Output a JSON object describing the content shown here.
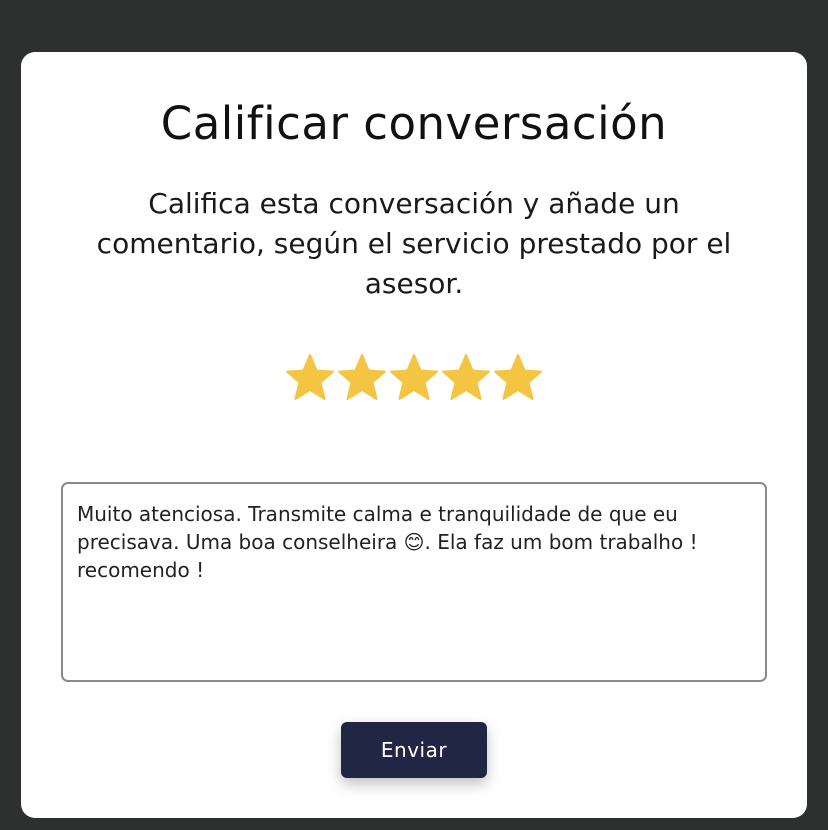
{
  "modal": {
    "title": "Calificar conversación",
    "subtitle": "Califica esta conversación y añade un comentario, según el servicio prestado por el asesor."
  },
  "rating": {
    "value": 5,
    "max": 5,
    "star_color": "#F4C542",
    "icon": "star-icon"
  },
  "comment": {
    "value": "Muito atenciosa. Transmite calma e tranquilidade de que eu precisava. Uma boa conselheira 😊. Ela faz um bom trabalho ! recomendo !"
  },
  "actions": {
    "send_label": "Enviar"
  },
  "colors": {
    "backdrop": "#2E3030",
    "button_bg": "#222645"
  }
}
